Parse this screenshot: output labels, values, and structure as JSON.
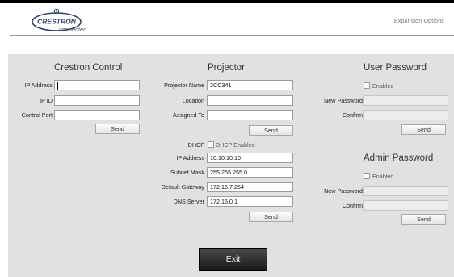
{
  "header": {
    "brand": "CRESTRON",
    "brand_sub": "connected",
    "expansion_options": "Expansion Options"
  },
  "crestron_control": {
    "title": "Crestron Control",
    "ip_address_label": "IP Address",
    "ip_address_value": "",
    "ip_id_label": "IP ID",
    "ip_id_value": "",
    "control_port_label": "Control Port",
    "control_port_value": "",
    "send_label": "Send"
  },
  "projector": {
    "title": "Projector",
    "projector_name_label": "Projector Name",
    "projector_name_value": "2CC341",
    "location_label": "Location",
    "location_value": "",
    "assigned_to_label": "Assigned To",
    "assigned_to_value": "",
    "send_label": "Send",
    "dhcp_label": "DHCP",
    "dhcp_checkbox_label": "DHCP Enabled",
    "dhcp_enabled": false,
    "ip_address_label": "IP Address",
    "ip_address_value": "10.10.10.10",
    "subnet_mask_label": "Subnet Mask",
    "subnet_mask_value": "255.255.255.0",
    "default_gateway_label": "Default Gateway",
    "default_gateway_value": "172.16.7.254",
    "dns_server_label": "DNS Server",
    "dns_server_value": "172.16.0.1",
    "send2_label": "Send"
  },
  "user_password": {
    "title": "User Password",
    "enabled_label": "Enabled",
    "enabled": false,
    "new_password_label": "New Password",
    "confirm_label": "Confirm",
    "send_label": "Send"
  },
  "admin_password": {
    "title": "Admin Password",
    "enabled_label": "Enabled",
    "enabled": false,
    "new_password_label": "New Password",
    "confirm_label": "Confirm",
    "send_label": "Send"
  },
  "exit_label": "Exit"
}
